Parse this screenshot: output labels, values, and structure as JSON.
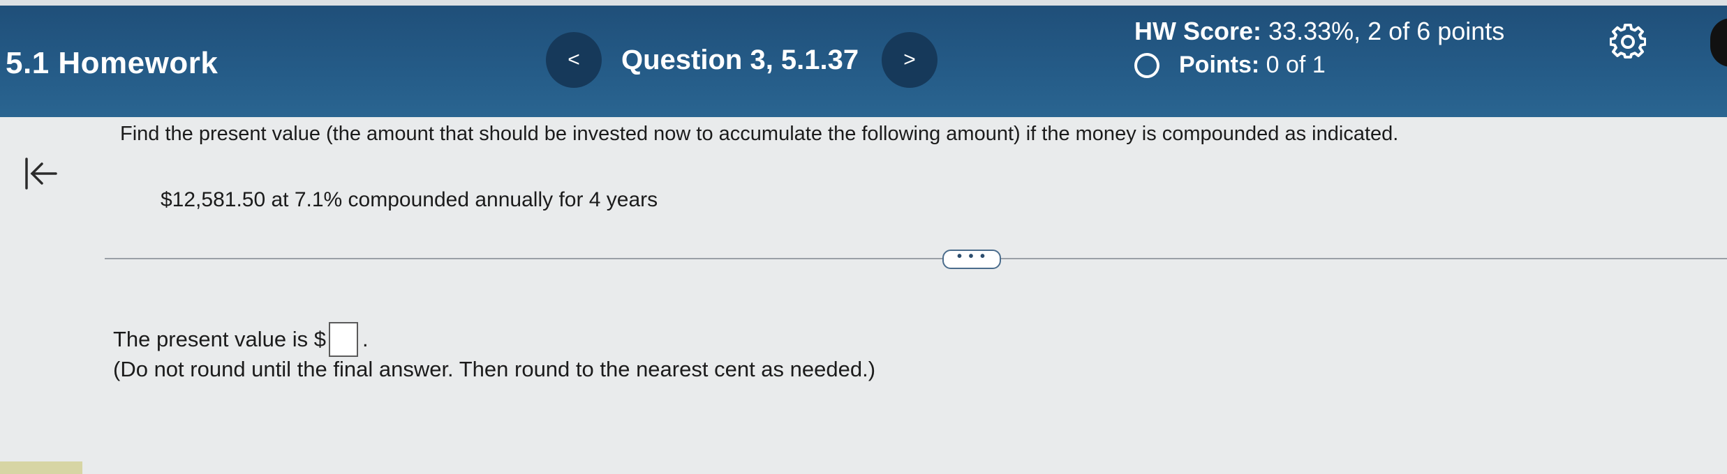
{
  "header": {
    "title": "5.1 Homework",
    "prev_label": "<",
    "question_label": "Question 3, 5.1.37",
    "next_label": ">",
    "hw_score_label": "HW Score:",
    "hw_score_value": "33.33%, 2 of 6 points",
    "points_label": "Points:",
    "points_value": "0 of 1",
    "settings_icon": "gear-icon"
  },
  "sidebar": {
    "back_icon": "collapse-left-icon"
  },
  "problem": {
    "prompt": "Find the present value (the amount that should be invested now to accumulate the following amount) if the money is compounded as indicated.",
    "data_line": "$12,581.50 at 7.1% compounded annually for 4 years",
    "more_label": "• • •"
  },
  "answer": {
    "prefix": "The present value is $",
    "value": "",
    "suffix": ".",
    "instruction": "(Do not round until the final answer. Then round to the nearest cent as needed.)"
  },
  "colors": {
    "header_bg": "#245a86",
    "nav_button_bg": "#16395a",
    "page_bg": "#e9ebec"
  }
}
